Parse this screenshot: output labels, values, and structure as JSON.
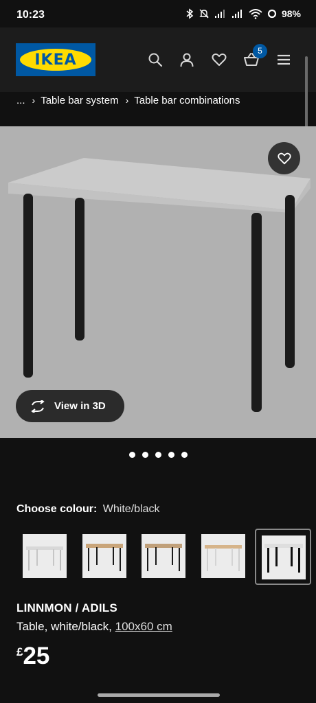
{
  "status_bar": {
    "time": "10:23",
    "battery": "98%",
    "icons": [
      "bluetooth-icon",
      "bell-muted-icon",
      "signal-icon",
      "signal-icon",
      "wifi-icon",
      "battery-icon"
    ]
  },
  "header": {
    "logo_text": "IKEA",
    "icons": [
      "search-icon",
      "account-icon",
      "heart-icon",
      "basket-icon",
      "menu-icon"
    ],
    "cart_count": "5"
  },
  "breadcrumb": {
    "ellipsis": "...",
    "items": [
      "Table bar system",
      "Table bar combinations"
    ]
  },
  "hero": {
    "view_3d_label": "View in 3D",
    "carousel_dots": 5
  },
  "colour": {
    "label": "Choose colour:",
    "value": "White/black",
    "swatches": [
      {
        "name": "white-white",
        "top": "#e8e8e8",
        "legs": "#d0d0d0"
      },
      {
        "name": "oak-black",
        "top": "#c9a57a",
        "legs": "#1a1a1a"
      },
      {
        "name": "oak-black-2",
        "top": "#c0a07a",
        "legs": "#1a1a1a"
      },
      {
        "name": "oak-white",
        "top": "#d6b48a",
        "legs": "#e0e0e0"
      },
      {
        "name": "white-black",
        "top": "#e8e8e8",
        "legs": "#111111"
      }
    ]
  },
  "product": {
    "name": "LINNMON / ADILS",
    "description": "Table, white/black,",
    "size": "100x60 cm",
    "currency": "£",
    "price": "25"
  },
  "colors": {
    "background": "#111111",
    "hero_background": "#b1b1b1",
    "ikea_blue": "#0058a3",
    "ikea_yellow": "#ffdb00"
  }
}
